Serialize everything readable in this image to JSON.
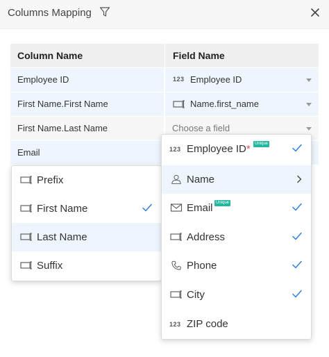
{
  "header": {
    "title": "Columns Mapping"
  },
  "table": {
    "headers": {
      "column": "Column Name",
      "field": "Field Name"
    },
    "rows": [
      {
        "column": "Employee ID",
        "field": "Employee ID",
        "field_icon": "123"
      },
      {
        "column": "First Name.First Name",
        "field": "Name.first_name",
        "field_icon": "text-field-icon"
      },
      {
        "column": "First Name.Last Name",
        "field": "",
        "placeholder": "Choose a field"
      },
      {
        "column": "Email",
        "field": ""
      }
    ]
  },
  "subfield_menu": {
    "items": [
      {
        "label": "Prefix",
        "checked": false,
        "active": false
      },
      {
        "label": "First Name",
        "checked": true,
        "active": false
      },
      {
        "label": "Last Name",
        "checked": false,
        "active": true
      },
      {
        "label": "Suffix",
        "checked": false,
        "active": false
      }
    ]
  },
  "field_menu": {
    "unique_badge": "Unique",
    "required_mark": "*",
    "items": [
      {
        "label": "Employee ID",
        "icon": "123",
        "checked": true,
        "required": true,
        "unique": true
      },
      {
        "label": "Name",
        "icon": "person-icon",
        "checked": false,
        "submenu": true,
        "active": true
      },
      {
        "label": "Email",
        "icon": "mail-icon",
        "checked": true,
        "unique": true
      },
      {
        "label": "Address",
        "icon": "text-field-icon",
        "checked": true
      },
      {
        "label": "Phone",
        "icon": "phone-icon",
        "checked": true
      },
      {
        "label": "City",
        "icon": "text-field-icon",
        "checked": true
      },
      {
        "label": "ZIP code",
        "icon": "123",
        "checked": false
      }
    ]
  },
  "colors": {
    "accent": "#2f7fd8",
    "selected_bg": "#eef5fd",
    "unique_badge": "#23b7a0",
    "required": "#e64a4a"
  }
}
